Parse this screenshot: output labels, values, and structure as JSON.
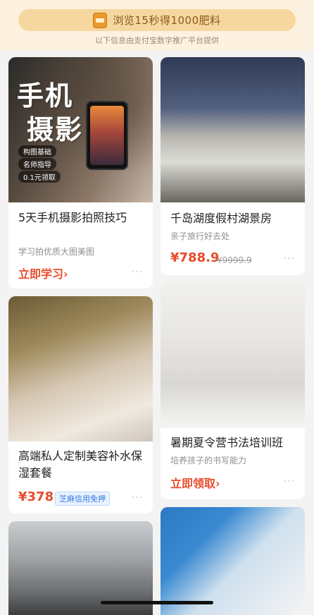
{
  "banner": {
    "text": "浏览15秒得1000肥料",
    "subtext": "以下信息由支付宝数字推广平台提供"
  },
  "cards": {
    "photo": {
      "image_title_line1": "手机",
      "image_title_line2": "摄影",
      "tags": [
        "构图基础",
        "名师指导",
        "0.1元领取"
      ],
      "title": "5天手机摄影拍照技巧",
      "subtitle": "学习拍优质大图美图",
      "cta": "立即学习",
      "cta_icon": "chevron-right-icon"
    },
    "hotel": {
      "title": "千岛湖度假村湖景房",
      "subtitle": "亲子旅行好去处",
      "price": "¥788.9",
      "old_price": "¥9999.9"
    },
    "spa": {
      "title": "高端私人定制美容补水保湿套餐",
      "price": "¥378",
      "badge": "芝麻信用免押"
    },
    "calligraphy": {
      "title": "暑期夏令营书法培训班",
      "subtitle": "培养孩子的书写能力",
      "cta": "立即领取",
      "cta_icon": "chevron-right-icon"
    }
  },
  "more_label": "···",
  "colors": {
    "accent": "#e84b2b",
    "banner_bg": "#f6d79f",
    "badge_blue": "#2f7ce6"
  }
}
